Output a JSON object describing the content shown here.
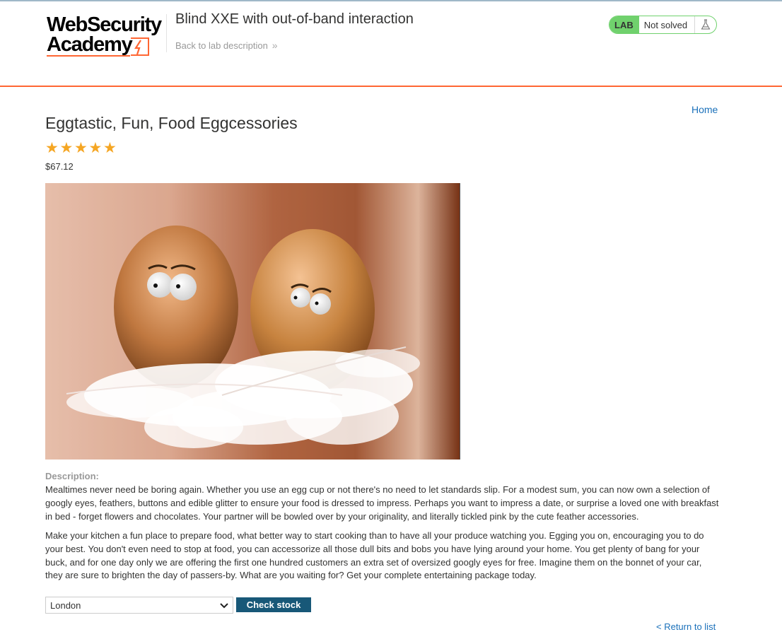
{
  "header": {
    "logo_line1": "WebSecurity",
    "logo_line2": "Academy",
    "lab_title": "Blind XXE with out-of-band interaction",
    "back_link": "Back to lab description",
    "status_badge": "LAB",
    "status_text": "Not solved"
  },
  "nav": {
    "home": "Home"
  },
  "product": {
    "title": "Eggtastic, Fun, Food Eggcessories",
    "rating": 5,
    "stars": [
      "★",
      "★",
      "★",
      "★",
      "★"
    ],
    "price": "$67.12",
    "image_subject": "two-eggs-with-googly-eyes-on-feathers",
    "description_label": "Description:",
    "description_p1": "Mealtimes never need be boring again. Whether you use an egg cup or not there's no need to let standards slip. For a modest sum, you can now own a selection of googly eyes, feathers, buttons and edible glitter to ensure your food is dressed to impress. Perhaps you want to impress a date, or surprise a loved one with breakfast in bed - forget flowers and chocolates. Your partner will be bowled over by your originality, and literally tickled pink by the cute feather accessories.",
    "description_p2": "Make your kitchen a fun place to prepare food, what better way to start cooking than to have all your produce watching you. Egging you on, encouraging you to do your best. You don't even need to stop at food, you can accessorize all those dull bits and bobs you have lying around your home. You get plenty of bang for your buck, and for one day only we are offering the first one hundred customers an extra set of oversized googly eyes for free. Imagine them on the bonnet of your car, they are sure to brighten the day of passers-by. What are you waiting for? Get your complete entertaining package today."
  },
  "stock": {
    "selected_store": "London",
    "check_button": "Check stock"
  },
  "footer": {
    "return_link": "< Return to list"
  },
  "colors": {
    "accent_orange": "#ff6633",
    "link_blue": "#1a70ba",
    "button_blue": "#185878",
    "status_green": "#70d16d",
    "star_gold": "#f5a623"
  },
  "icons": {
    "back_chevron": "double-chevron-right-icon",
    "flask": "flask-icon",
    "select_chevron": "chevron-down-icon"
  }
}
